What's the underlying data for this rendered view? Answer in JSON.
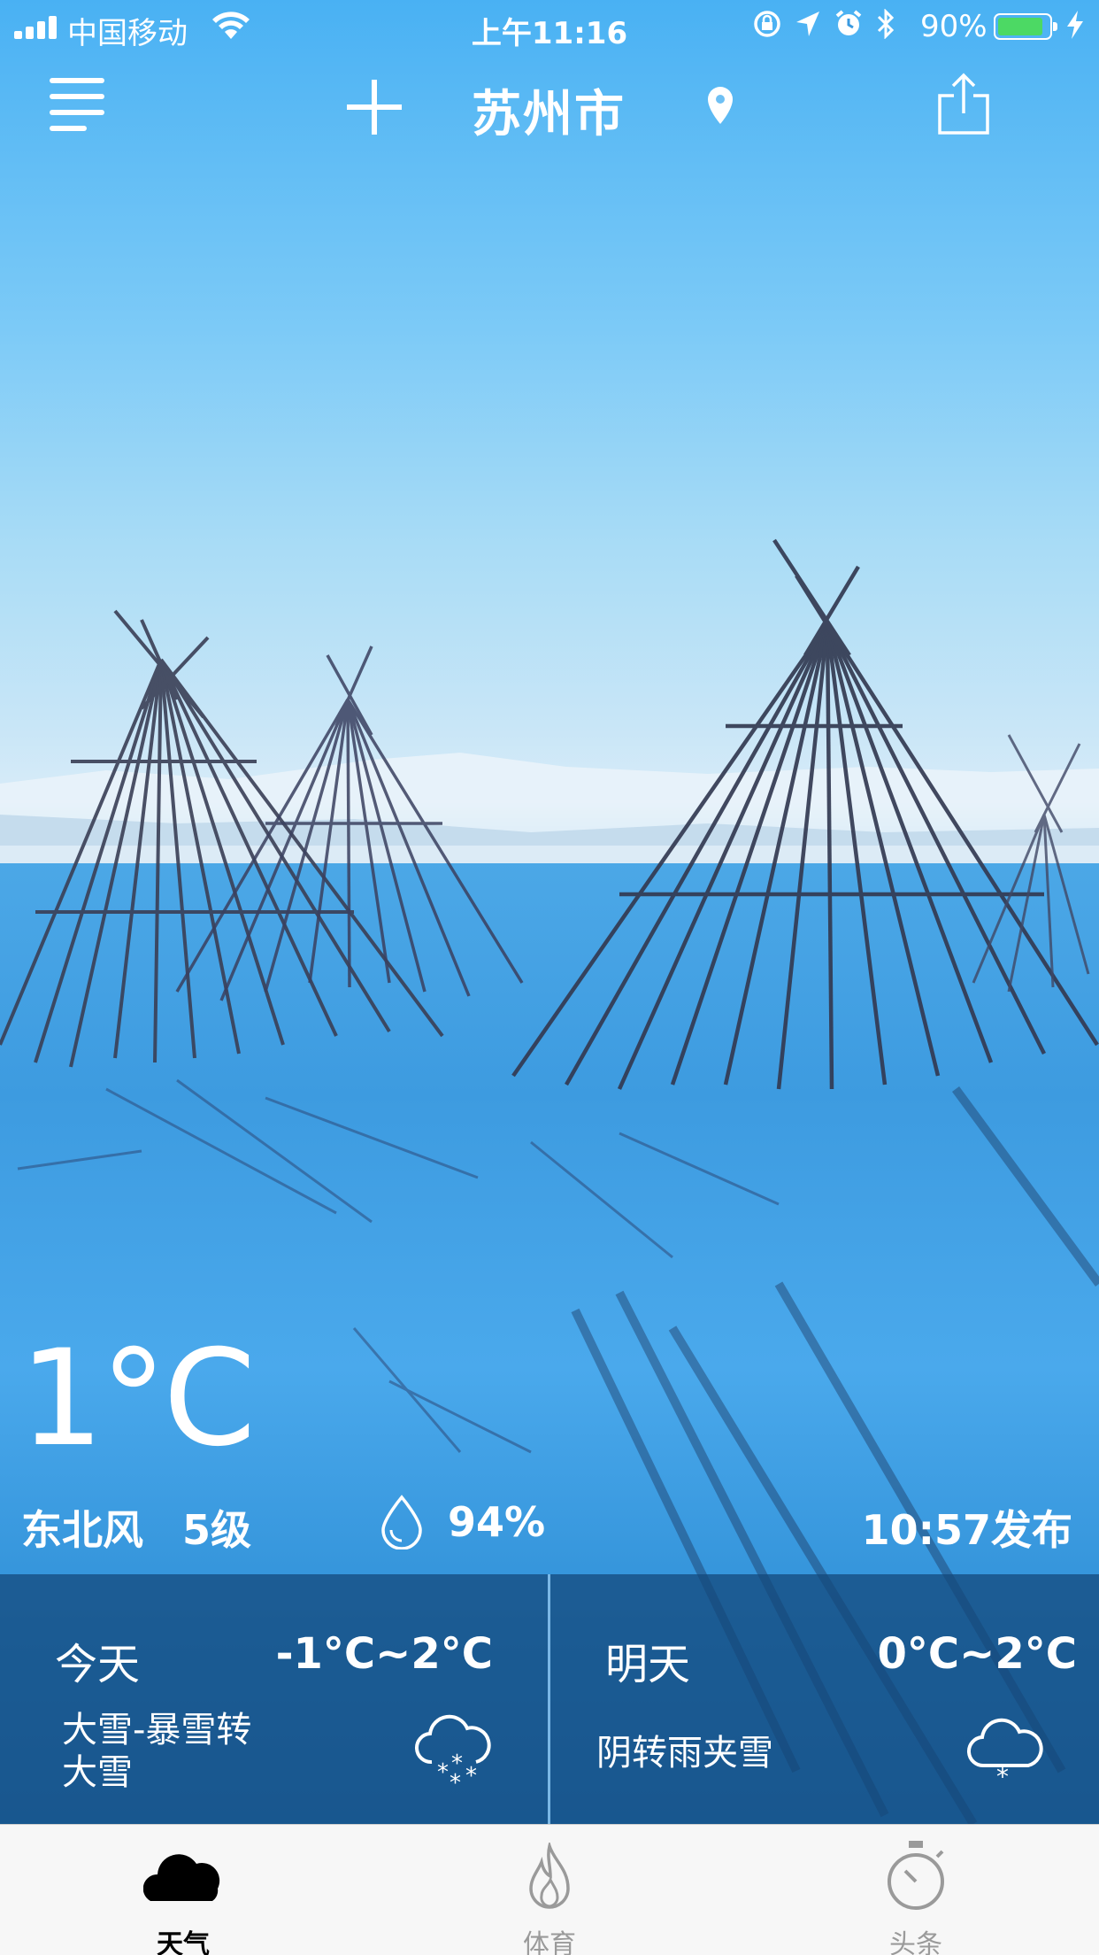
{
  "status_bar": {
    "carrier": "中国移动",
    "time": "上午11:16",
    "battery_percent": "90%",
    "battery_level": 0.9,
    "icons": [
      "signal-icon",
      "wifi-icon",
      "rotation-lock-icon",
      "location-arrow-icon",
      "alarm-icon",
      "bluetooth-icon",
      "battery-icon",
      "charging-icon"
    ]
  },
  "nav": {
    "city": "苏州市",
    "icons": [
      "menu-icon",
      "add-icon",
      "location-pin-icon",
      "share-icon"
    ]
  },
  "current": {
    "temperature": "1°C",
    "wind_direction": "东北风",
    "wind_level": "5级",
    "humidity": "94%",
    "publish_time": "10:57发布"
  },
  "forecast": {
    "today": {
      "day": "今天",
      "range": "-1°C~2°C",
      "desc_line1": "大雪-暴雪转",
      "desc_line2": "大雪",
      "icon": "heavy-snow-icon"
    },
    "tomorrow": {
      "day": "明天",
      "range": "0°C~2°C",
      "desc": "阴转雨夹雪",
      "icon": "sleet-icon"
    }
  },
  "tabbar": {
    "tabs": [
      {
        "label": "天气",
        "icon": "cloud-icon",
        "active": true
      },
      {
        "label": "体育",
        "icon": "flame-icon",
        "active": false
      },
      {
        "label": "头条",
        "icon": "stopwatch-icon",
        "active": false
      }
    ]
  },
  "colors": {
    "sky_top": "#49b1f3",
    "snow": "#4aa9ec",
    "forecast_panel": "#14467a",
    "divider": "#8cc8f5",
    "battery_fill": "#4cd964",
    "tab_active": "#000000",
    "tab_inactive": "#9a9a9a"
  }
}
